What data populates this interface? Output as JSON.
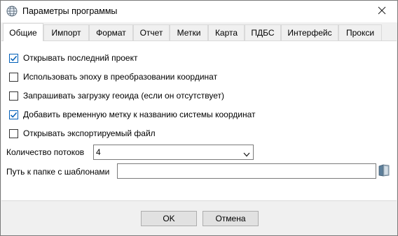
{
  "window": {
    "title": "Параметры программы"
  },
  "tabs": [
    {
      "label": "Общие",
      "active": true
    },
    {
      "label": "Импорт"
    },
    {
      "label": "Формат"
    },
    {
      "label": "Отчет"
    },
    {
      "label": "Метки"
    },
    {
      "label": "Карта"
    },
    {
      "label": "ПДБС"
    },
    {
      "label": "Интерфейс"
    },
    {
      "label": "Прокси"
    }
  ],
  "options": [
    {
      "label": "Открывать последний проект",
      "checked": true
    },
    {
      "label": "Использовать эпоху в преобразовании координат",
      "checked": false
    },
    {
      "label": "Запрашивать загрузку геоида (если он отсутствует)",
      "checked": false
    },
    {
      "label": "Добавить временную метку к названию системы координат",
      "checked": true
    },
    {
      "label": "Открывать экспортируемый файл",
      "checked": false
    }
  ],
  "threads": {
    "label": "Количество потоков",
    "value": "4"
  },
  "templates": {
    "label": "Путь к папке с шаблонами",
    "value": ""
  },
  "buttons": {
    "ok": "OK",
    "cancel": "Отмена"
  },
  "colors": {
    "accent": "#005fb8",
    "panel": "#ffffff",
    "chrome": "#f0f0f0"
  }
}
